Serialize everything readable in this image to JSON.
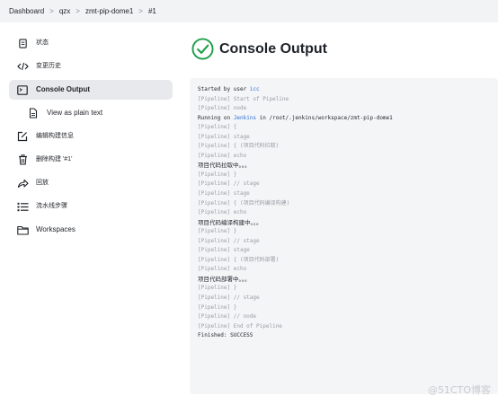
{
  "breadcrumb": {
    "items": [
      "Dashboard",
      "qzx",
      "zmt-pip-dome1",
      "#1"
    ],
    "separator": ">"
  },
  "sidebar": {
    "items": [
      {
        "label": "状态",
        "icon": "document-icon"
      },
      {
        "label": "变更历史",
        "icon": "code-icon"
      },
      {
        "label": "Console Output",
        "icon": "terminal-icon",
        "active": true
      },
      {
        "label": "View as plain text",
        "icon": "file-icon",
        "sub": true
      },
      {
        "label": "编辑构建信息",
        "icon": "edit-icon"
      },
      {
        "label": "删除构建 '#1'",
        "icon": "trash-icon"
      },
      {
        "label": "回放",
        "icon": "replay-icon"
      },
      {
        "label": "流水线步骤",
        "icon": "list-icon"
      },
      {
        "label": "Workspaces",
        "icon": "folder-icon"
      }
    ]
  },
  "main": {
    "title": "Console Output",
    "status_icon": "success-check-icon",
    "status_color": "#1e9e4a"
  },
  "console": {
    "started_prefix": "Started by user ",
    "started_user": "icc",
    "running_prefix": "Running on ",
    "running_node": "Jenkins",
    "running_suffix": " in /root/.jenkins/workspace/zmt-pip-dome1",
    "lines": [
      {
        "kind": "pipe",
        "text": "[Pipeline] Start of Pipeline"
      },
      {
        "kind": "pipe",
        "text": "[Pipeline] node"
      },
      {
        "kind": "running"
      },
      {
        "kind": "pipe",
        "text": "[Pipeline] {"
      },
      {
        "kind": "pipe",
        "text": "[Pipeline] stage"
      },
      {
        "kind": "pipe",
        "text": "[Pipeline] { (项目代码拉取)"
      },
      {
        "kind": "pipe",
        "text": "[Pipeline] echo"
      },
      {
        "kind": "cjk",
        "text": "项目代码拉取中。。。"
      },
      {
        "kind": "pipe",
        "text": "[Pipeline] }"
      },
      {
        "kind": "pipe",
        "text": "[Pipeline] // stage"
      },
      {
        "kind": "pipe",
        "text": "[Pipeline] stage"
      },
      {
        "kind": "pipe",
        "text": "[Pipeline] { (项目代码编译构建)"
      },
      {
        "kind": "pipe",
        "text": "[Pipeline] echo"
      },
      {
        "kind": "cjk",
        "text": "项目代码编译构建中。。。"
      },
      {
        "kind": "pipe",
        "text": "[Pipeline] }"
      },
      {
        "kind": "pipe",
        "text": "[Pipeline] // stage"
      },
      {
        "kind": "pipe",
        "text": "[Pipeline] stage"
      },
      {
        "kind": "pipe",
        "text": "[Pipeline] { (项目代码部署)"
      },
      {
        "kind": "pipe",
        "text": "[Pipeline] echo"
      },
      {
        "kind": "cjk",
        "text": "项目代码部署中。。。"
      },
      {
        "kind": "pipe",
        "text": "[Pipeline] }"
      },
      {
        "kind": "pipe",
        "text": "[Pipeline] // stage"
      },
      {
        "kind": "pipe",
        "text": "[Pipeline] }"
      },
      {
        "kind": "pipe",
        "text": "[Pipeline] // node"
      },
      {
        "kind": "pipe",
        "text": "[Pipeline] End of Pipeline"
      },
      {
        "kind": "plain",
        "text": "Finished: SUCCESS"
      }
    ]
  },
  "watermark": "@51CTO博客"
}
